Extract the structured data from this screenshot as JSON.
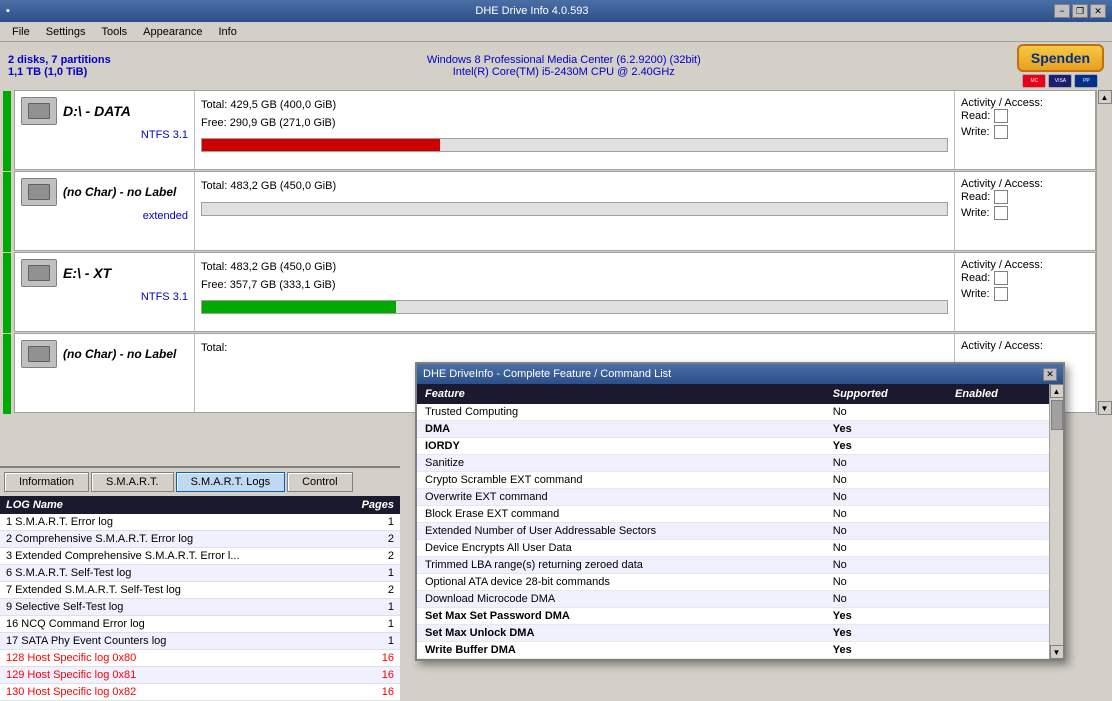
{
  "titlebar": {
    "title": "DHE Drive Info 4.0.593",
    "min": "−",
    "restore": "❐",
    "close": "✕"
  },
  "menu": {
    "items": [
      "File",
      "Settings",
      "Tools",
      "Appearance",
      "Info"
    ]
  },
  "infobar": {
    "line1": "2 disks, 7 partitions",
    "line2": "1,1 TB (1,0 TiB)",
    "center1": "Windows 8 Professional Media Center (6.2.9200) (32bit)",
    "center2": "Intel(R) Core(TM) i5-2430M CPU @ 2.40GHz",
    "spenden": "Spenden"
  },
  "drives": [
    {
      "label": "D:\\ - DATA",
      "fs": "NTFS 3.1",
      "total": "Total: 429,5 GB (400,0 GiB)",
      "free": "Free: 290,9 GB (271,0 GiB)",
      "bar_pct": 32,
      "bar_type": "red",
      "activity_label": "Activity / Access:",
      "read_label": "Read:",
      "write_label": "Write:"
    },
    {
      "label": "(no Char) - no Label",
      "fs": "extended",
      "total": "Total: 483,2 GB (450,0 GiB)",
      "free": "",
      "bar_pct": 0,
      "bar_type": "none",
      "activity_label": "Activity / Access:",
      "read_label": "Read:",
      "write_label": "Write:"
    },
    {
      "label": "E:\\ - XT",
      "fs": "NTFS 3.1",
      "total": "Total: 483,2 GB (450,0 GiB)",
      "free": "Free: 357,7 GB (333,1 GiB)",
      "bar_pct": 26,
      "bar_type": "green",
      "activity_label": "Activity / Access:",
      "read_label": "Read:",
      "write_label": "Write:"
    },
    {
      "label": "(no Char) - no Label",
      "fs": "",
      "total": "Total:",
      "free": "",
      "bar_pct": 0,
      "bar_type": "none",
      "activity_label": "Activity / Access:",
      "read_label": "",
      "write_label": ""
    }
  ],
  "tabs": {
    "information": "Information",
    "smart": "S.M.A.R.T.",
    "smart_logs": "S.M.A.R.T. Logs",
    "control": "Control",
    "active": "S.M.A.R.T. Logs"
  },
  "log_table": {
    "col_name": "LOG Name",
    "col_pages": "Pages",
    "rows": [
      {
        "name": "1 S.M.A.R.T. Error log",
        "pages": "1",
        "red": false
      },
      {
        "name": "2 Comprehensive S.M.A.R.T. Error log",
        "pages": "2",
        "red": false
      },
      {
        "name": "3 Extended Comprehensive S.M.A.R.T. Error l...",
        "pages": "2",
        "red": false
      },
      {
        "name": "6 S.M.A.R.T. Self-Test log",
        "pages": "1",
        "red": false
      },
      {
        "name": "7 Extended S.M.A.R.T. Self-Test log",
        "pages": "2",
        "red": false
      },
      {
        "name": "9 Selective Self-Test log",
        "pages": "1",
        "red": false
      },
      {
        "name": "16 NCQ Command Error log",
        "pages": "1",
        "red": false
      },
      {
        "name": "17 SATA Phy Event Counters log",
        "pages": "1",
        "red": false
      },
      {
        "name": "128 Host Specific log 0x80",
        "pages": "16",
        "red": true
      },
      {
        "name": "129 Host Specific log 0x81",
        "pages": "16",
        "red": true
      },
      {
        "name": "130 Host Specific log 0x82",
        "pages": "16",
        "red": true
      }
    ]
  },
  "feature_popup": {
    "title": "DHE DriveInfo - Complete Feature / Command List",
    "col_feature": "Feature",
    "col_supported": "Supported",
    "col_enabled": "Enabled",
    "rows": [
      {
        "name": "Trusted Computing",
        "supported": "No",
        "enabled": "",
        "bold": false
      },
      {
        "name": "DMA",
        "supported": "Yes",
        "enabled": "",
        "bold": true
      },
      {
        "name": "IORDY",
        "supported": "Yes",
        "enabled": "",
        "bold": true
      },
      {
        "name": "Sanitize",
        "supported": "No",
        "enabled": "",
        "bold": false
      },
      {
        "name": "Crypto Scramble EXT command",
        "supported": "No",
        "enabled": "",
        "bold": false
      },
      {
        "name": "Overwrite EXT command",
        "supported": "No",
        "enabled": "",
        "bold": false
      },
      {
        "name": "Block Erase EXT command",
        "supported": "No",
        "enabled": "",
        "bold": false
      },
      {
        "name": "Extended Number of User Addressable Sectors",
        "supported": "No",
        "enabled": "",
        "bold": false
      },
      {
        "name": "Device Encrypts All User Data",
        "supported": "No",
        "enabled": "",
        "bold": false
      },
      {
        "name": "Trimmed LBA range(s) returning zeroed data",
        "supported": "No",
        "enabled": "",
        "bold": false
      },
      {
        "name": "Optional ATA device 28-bit commands",
        "supported": "No",
        "enabled": "",
        "bold": false
      },
      {
        "name": "Download Microcode DMA",
        "supported": "No",
        "enabled": "",
        "bold": false
      },
      {
        "name": "Set Max Set Password DMA",
        "supported": "Yes",
        "enabled": "",
        "bold": true
      },
      {
        "name": "Set Max Unlock DMA",
        "supported": "Yes",
        "enabled": "",
        "bold": true
      },
      {
        "name": "Write Buffer DMA",
        "supported": "Yes",
        "enabled": "",
        "bold": true
      }
    ]
  }
}
